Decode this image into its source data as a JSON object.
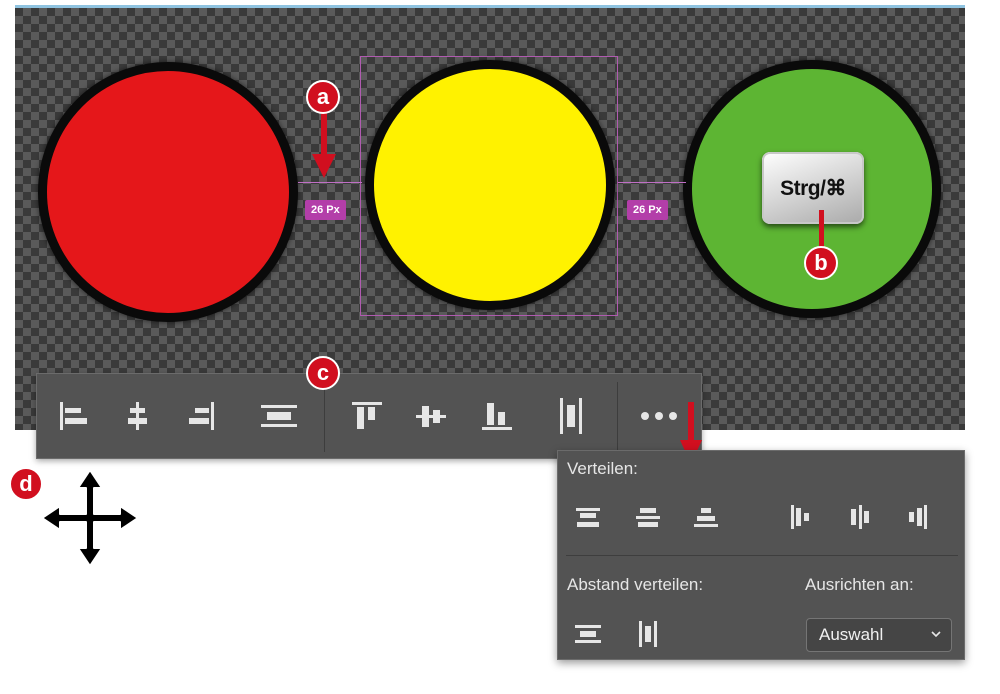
{
  "canvas": {
    "circles": [
      {
        "name": "red-light",
        "color": "#e5171a"
      },
      {
        "name": "yellow-light",
        "color": "#fff200"
      },
      {
        "name": "green-light",
        "color": "#5db533"
      }
    ],
    "gap_left_label": "26 Px",
    "gap_right_label": "26 Px",
    "key_label": "Strg/⌘"
  },
  "markers": {
    "a": "a",
    "b": "b",
    "c": "c",
    "d": "d"
  },
  "colors": {
    "marker_red": "#d10f1f",
    "selection": "#b05bb0",
    "badge": "#b33ea9",
    "toolbar_bg": "#535353"
  },
  "toolbar": {
    "icons": [
      "align-left-edges-icon",
      "align-horizontal-centers-icon",
      "align-right-edges-icon",
      "distribute-vertical-spacing-icon",
      "align-top-edges-icon",
      "align-vertical-centers-icon",
      "align-bottom-edges-icon",
      "distribute-horizontal-spacing-icon",
      "more-options-icon"
    ]
  },
  "panel": {
    "distribute_label": "Verteilen:",
    "distribute_spacing_label": "Abstand verteilen:",
    "align_to_label": "Ausrichten an:",
    "align_to_value": "Auswahl"
  }
}
